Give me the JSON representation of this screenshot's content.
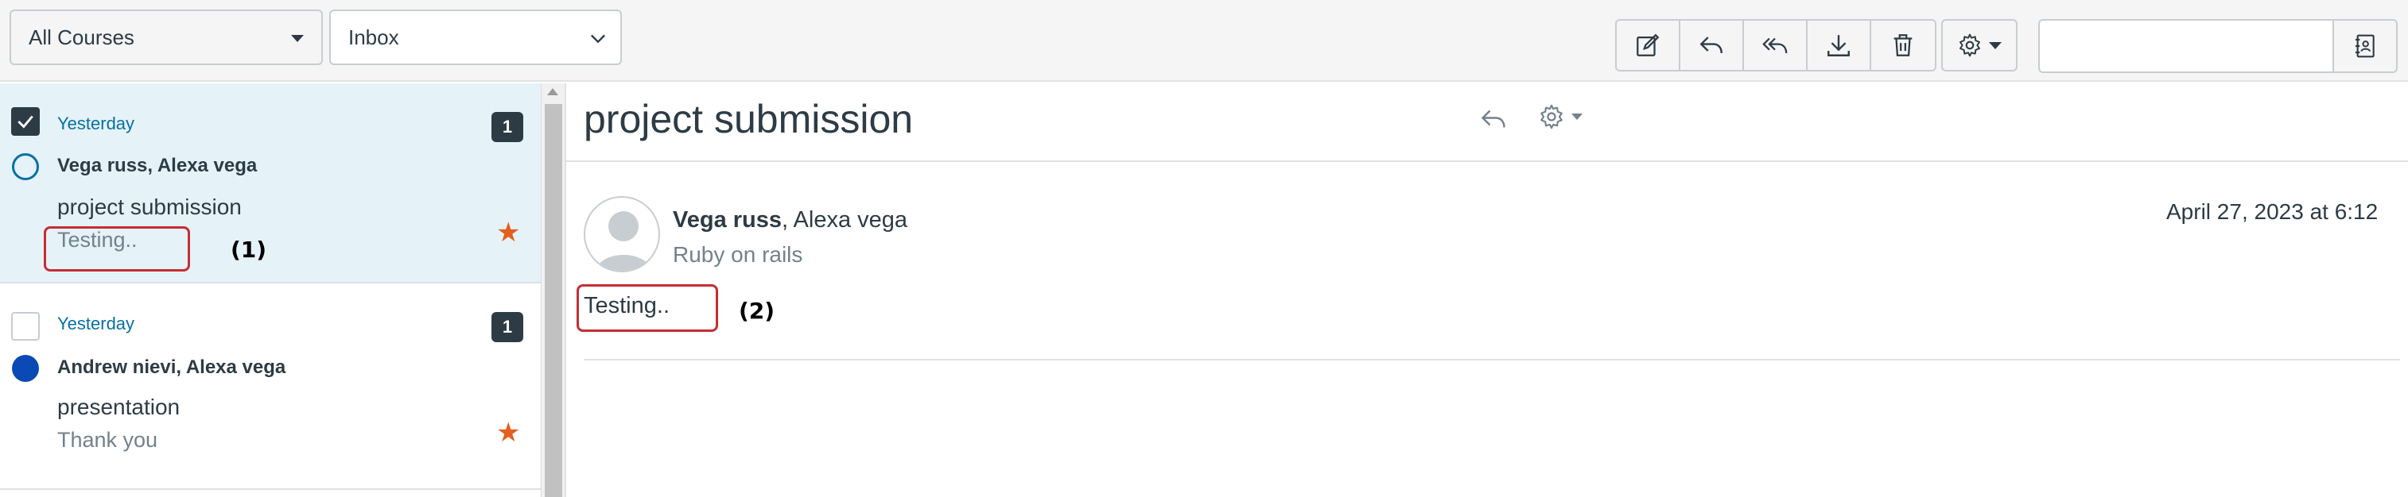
{
  "toolbar": {
    "course_select": "All Courses",
    "mailbox_select": "Inbox",
    "search": {
      "value": ""
    },
    "buttons": [
      "compose-icon",
      "reply-icon",
      "reply-all-icon",
      "download-icon",
      "trash-icon",
      "gear-icon",
      "address-book-icon"
    ]
  },
  "conversations": [
    {
      "date": "Yesterday",
      "count": "1",
      "participants": "Vega russ, Alexa vega",
      "subject": "project submission",
      "preview": "Testing..",
      "selected": true,
      "read_state": "read",
      "starred": true,
      "annotation": "(1)"
    },
    {
      "date": "Yesterday",
      "count": "1",
      "participants": "Andrew nievi, Alexa vega",
      "subject": "presentation",
      "preview": "Thank you",
      "selected": false,
      "read_state": "unread",
      "starred": true
    }
  ],
  "message": {
    "title": "project submission",
    "sender": "Vega russ",
    "recipients": ", Alexa vega",
    "course": "Ruby on rails",
    "date": "April 27, 2023 at 6:12",
    "body": "Testing..",
    "annotation": "(2)"
  },
  "colors": {
    "selected_row": "#e5f2f8",
    "link_blue": "#0770a3",
    "star": "#e35f1e",
    "annotation_red": "#c62d35",
    "dark": "#2d3b45"
  }
}
